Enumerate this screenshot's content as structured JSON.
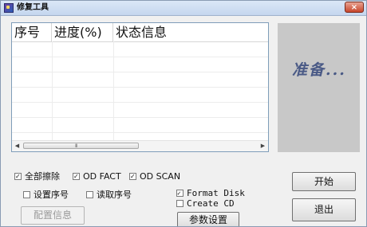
{
  "window": {
    "title": "修复工具",
    "close_label": "×"
  },
  "list": {
    "columns": [
      {
        "label": "序号"
      },
      {
        "label": "进度(%)"
      },
      {
        "label": "状态信息"
      }
    ],
    "rows": [],
    "scrollbar": {
      "left_arrow": "◀",
      "right_arrow": "▶",
      "grip": "III"
    }
  },
  "status": {
    "text": "准备..."
  },
  "options": {
    "full_erase": {
      "label": "全部擦除",
      "checked": true
    },
    "od_fact": {
      "label": "OD FACT",
      "checked": true
    },
    "od_scan": {
      "label": "OD SCAN",
      "checked": true
    },
    "set_serial": {
      "label": "设置序号",
      "checked": false
    },
    "read_serial": {
      "label": "读取序号",
      "checked": false
    },
    "format_disk": {
      "label": "Format Disk",
      "checked": true
    },
    "create_cd": {
      "label": "Create CD",
      "checked": false
    }
  },
  "buttons": {
    "start": "开始",
    "exit": "退出",
    "params": "参数设置",
    "config_info": "配置信息"
  }
}
